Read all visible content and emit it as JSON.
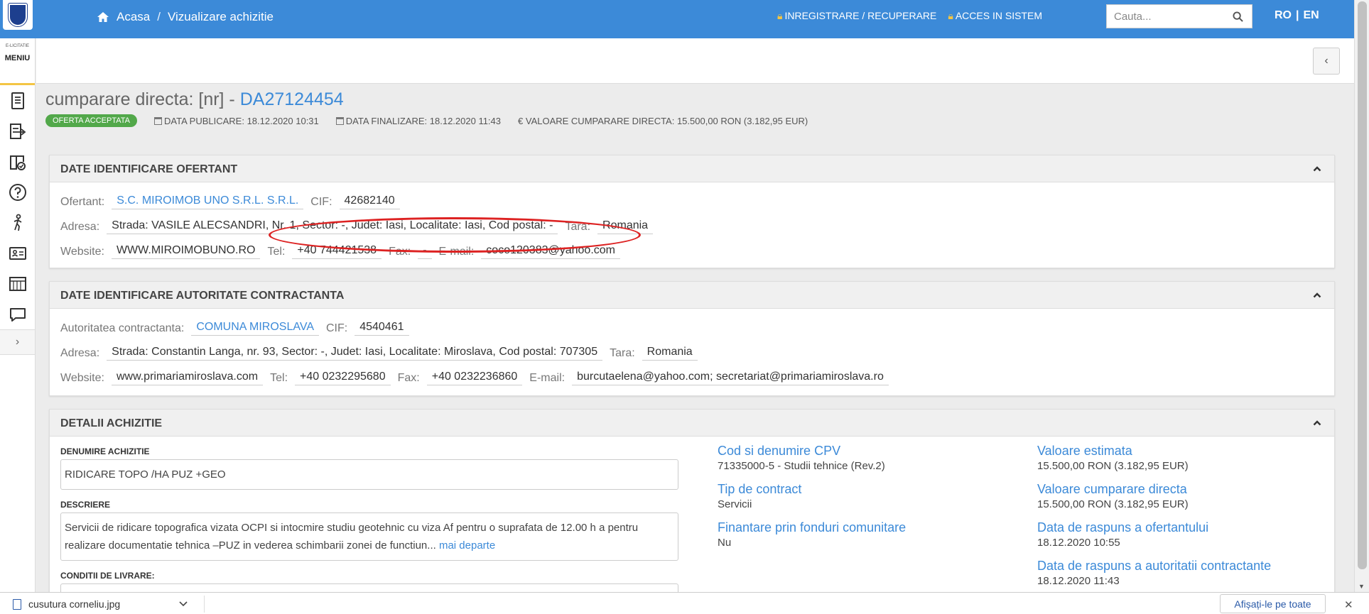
{
  "header": {
    "crumbs": [
      "Acasa",
      "Vizualizare achizitie"
    ],
    "register": "INREGISTRARE / RECUPERARE",
    "login": "ACCES IN SISTEM",
    "search_placeholder": "Cauta...",
    "lang_ro": "RO",
    "lang_sep": "|",
    "lang_en": "EN"
  },
  "sidebar": {
    "small_text": "E-LICITATIE",
    "menu_label": "MENIU",
    "icons": [
      "document-icon",
      "list-export-icon",
      "book-check-icon",
      "help-icon",
      "person-walk-icon",
      "contact-card-icon",
      "catalog-icon",
      "chat-icon"
    ]
  },
  "title": {
    "prefix": "cumparare directa: [nr] - ",
    "code": "DA27124454",
    "badge": "OFERTA ACCEPTATA",
    "publish": "DATA PUBLICARE: 18.12.2020 10:31",
    "finish": "DATA FINALIZARE: 18.12.2020 11:43",
    "value": "€ VALOARE CUMPARARE DIRECTA: 15.500,00  RON (3.182,95  EUR)"
  },
  "ofertant": {
    "heading": "DATE IDENTIFICARE OFERTANT",
    "l_ofertant": "Ofertant:",
    "ofertant": "S.C. MIROIMOB UNO S.R.L. S.R.L.",
    "l_cif": "CIF:",
    "cif": "42682140",
    "l_adresa": "Adresa:",
    "adresa": "Strada: VASILE ALECSANDRI, Nr. 1, Sector: -, Judet: Iasi, Localitate: Iasi, Cod postal: -",
    "l_tara": "Tara:",
    "tara": "Romania",
    "l_website": "Website:",
    "website": "WWW.MIROIMOBUNO.RO",
    "l_tel": "Tel:",
    "tel": "+40 744421538",
    "l_fax": "Fax:",
    "fax": "-",
    "l_email": "E-mail:",
    "email": "coco120383@yahoo.com"
  },
  "autoritate": {
    "heading": "DATE IDENTIFICARE AUTORITATE CONTRACTANTA",
    "l_autoritate": "Autoritatea contractanta:",
    "autoritate": "COMUNA MIROSLAVA",
    "l_cif": "CIF:",
    "cif": "4540461",
    "l_adresa": "Adresa:",
    "adresa": "Strada: Constantin Langa, nr. 93, Sector: -, Judet: Iasi, Localitate: Miroslava, Cod postal: 707305",
    "l_tara": "Tara:",
    "tara": "Romania",
    "l_website": "Website:",
    "website": "www.primariamiroslava.com",
    "l_tel": "Tel:",
    "tel": "+40 0232295680",
    "l_fax": "Fax:",
    "fax": "+40 0232236860",
    "l_email": "E-mail:",
    "email": "burcutaelena@yahoo.com; secretariat@primariamiroslava.ro"
  },
  "detalii": {
    "heading": "DETALII ACHIZITIE",
    "l_denumire": "DENUMIRE ACHIZITIE",
    "denumire": "RIDICARE TOPO /HA PUZ +GEO",
    "l_descriere": "DESCRIERE",
    "descriere": "Servicii de ridicare topografica vizata OCPI si intocmire studiu geotehnic cu viza Af pentru o suprafata de 12.00 h a pentru realizare documentatie tehnica –PUZ in vederea schimbarii zonei de functiun...",
    "more": "mai departe",
    "l_conditii": "CONDITII DE LIVRARE:",
    "l_cpv": "Cod si denumire CPV",
    "cpv": "71335000-5 - Studii tehnice (Rev.2)",
    "l_tip": "Tip de contract",
    "tip": "Servicii",
    "l_fonduri": "Finantare prin fonduri comunitare",
    "fonduri": "Nu",
    "l_estimata": "Valoare estimata",
    "estimata": "15.500,00  RON (3.182,95  EUR)",
    "l_valoare": "Valoare cumparare directa",
    "valoare": "15.500,00  RON (3.182,95  EUR)",
    "l_raspuns_of": "Data de raspuns a ofertantului",
    "raspuns_of": "18.12.2020 10:55",
    "l_raspuns_aut": "Data de raspuns a autoritatii contractante",
    "raspuns_aut": "18.12.2020 11:43"
  },
  "downloads": {
    "file": "cusutura corneliu.jpg",
    "show_all": "Afișați-le pe toate",
    "close": "✕"
  },
  "colors": {
    "topbar": "#3c8ad8",
    "accent": "#3c8ad8",
    "badge": "#52a84a",
    "highlight": "#dd2222"
  }
}
